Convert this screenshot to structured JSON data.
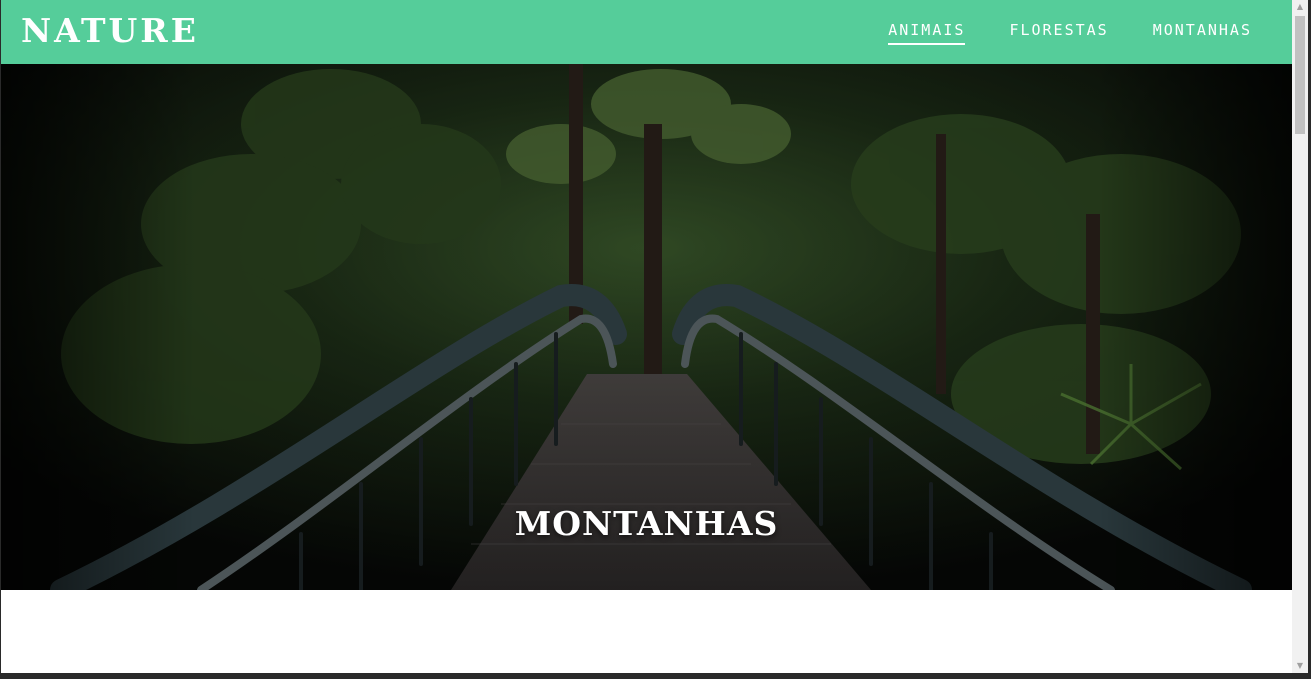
{
  "header": {
    "brand": "NATURE",
    "nav": [
      {
        "label": "ANIMAIS",
        "active": true
      },
      {
        "label": "FLORESTAS",
        "active": false
      },
      {
        "label": "MONTANHAS",
        "active": false
      }
    ]
  },
  "hero": {
    "title": "MONTANHAS",
    "image": "forest-bridge-photo"
  },
  "colors": {
    "header_bg": "#55cd9a",
    "text": "#ffffff"
  }
}
